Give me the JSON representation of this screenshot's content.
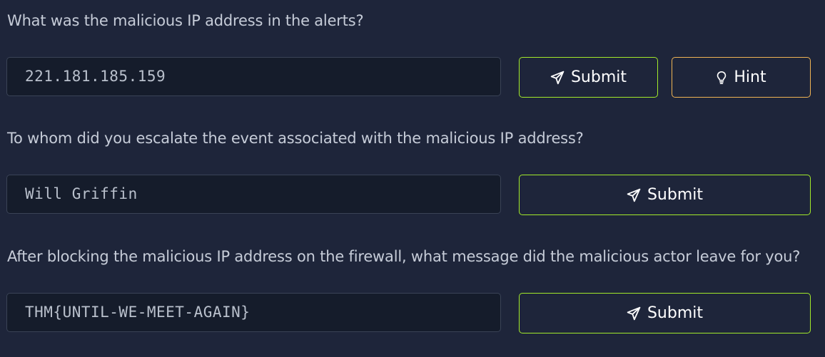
{
  "questions": [
    {
      "text": "What was the malicious IP address in the alerts?",
      "answer": "221.181.185.159",
      "submit_label": "Submit",
      "hint_label": "Hint"
    },
    {
      "text": "To whom did you escalate the event associated with the malicious IP address?",
      "answer": "Will Griffin",
      "submit_label": "Submit"
    },
    {
      "text": "After blocking the malicious IP address on the firewall, what message did the malicious actor leave for you?",
      "answer": "THM{UNTIL-WE-MEET-AGAIN}",
      "submit_label": "Submit"
    }
  ],
  "icons": {
    "submit": "paper-plane-icon",
    "hint": "lightbulb-icon"
  },
  "colors": {
    "background": "#1e253a",
    "input_background": "#151c2b",
    "submit_border": "#a3ea2a",
    "hint_border": "#f0b454"
  }
}
